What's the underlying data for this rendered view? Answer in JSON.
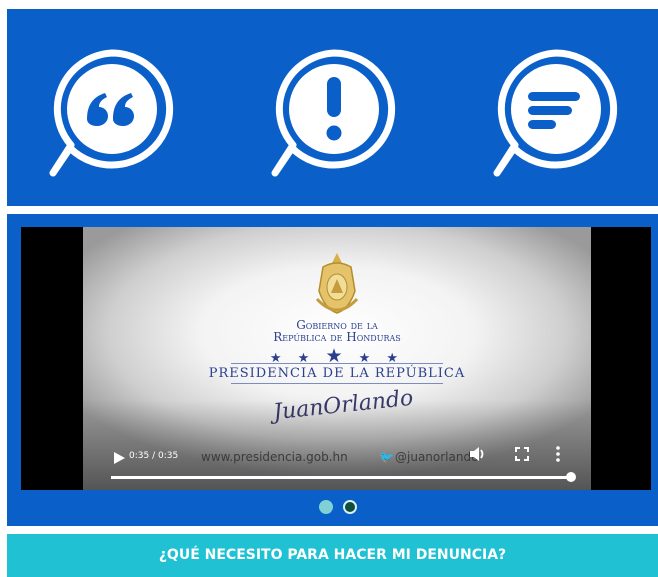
{
  "icons": [
    "quote-bubble-icon",
    "exclamation-bubble-icon",
    "text-lines-bubble-icon"
  ],
  "colors": {
    "panel_blue": "#0a5fc9",
    "banner_cyan": "#1fc1d3",
    "seal_gold": "#d7b04a"
  },
  "video": {
    "gov_line1": "Gobierno de la",
    "gov_line2": "República de Honduras",
    "presidency": "PRESIDENCIA DE LA REPÚBLICA",
    "signature": "JuanOrlando",
    "time": "0:35 / 0:35",
    "website": "www.presidencia.gob.hn",
    "twitter": "@juanorlando",
    "progress": 1.0
  },
  "carousel": {
    "count": 2,
    "active_index": 1
  },
  "banner": {
    "text": "¿QUÉ NECESITO PARA HACER MI DENUNCIA?"
  }
}
